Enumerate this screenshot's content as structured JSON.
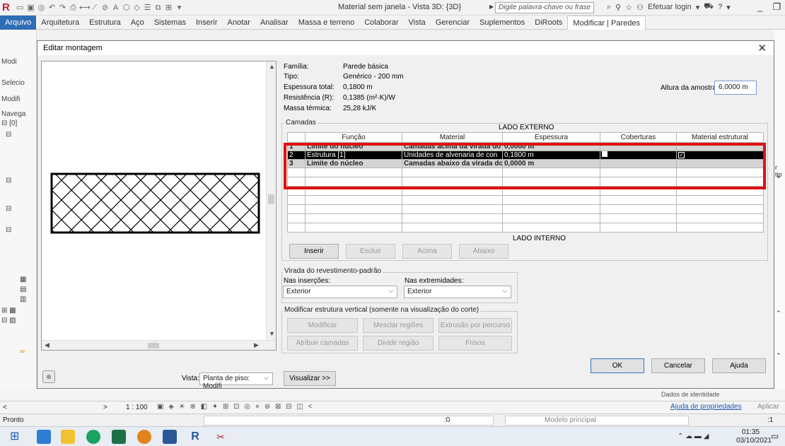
{
  "app": {
    "window_title": "Material sem janela - Vista 3D: {3D}",
    "search_placeholder": "Digite palavra-chave ou frase",
    "login": "Efetuar login",
    "ribbon_tabs": [
      "Arquivo",
      "Arquitetura",
      "Estrutura",
      "Aço",
      "Sistemas",
      "Inserir",
      "Anotar",
      "Analisar",
      "Massa e terreno",
      "Colaborar",
      "Vista",
      "Gerenciar",
      "Suplementos",
      "DiRoots",
      "Modificar | Paredes"
    ],
    "left_panel": {
      "modify": "Modi",
      "select": "Selecio",
      "modify2": "Modifi",
      "navigator": "Navega"
    }
  },
  "dialog": {
    "title": "Editar montagem",
    "properties": [
      {
        "label": "Família:",
        "value": "Parede básica"
      },
      {
        "label": "Tipo:",
        "value": "Genérico - 200 mm"
      },
      {
        "label": "Espessura total:",
        "value": "0,1800 m"
      },
      {
        "label": "Resistência (R):",
        "value": "0,1385 (m²·K)/W"
      },
      {
        "label": "Massa térmica:",
        "value": "25,28 kJ/K"
      }
    ],
    "sample_height_label": "Altura da amostra:",
    "sample_height_value": "6,0000 m",
    "layers_group": "Camadas",
    "exterior_side": "LADO EXTERNO",
    "interior_side": "LADO INTERNO",
    "columns": [
      "",
      "Função",
      "Material",
      "Espessura",
      "Coberturas",
      "Material estrutural"
    ],
    "rows": [
      {
        "num": "1",
        "function": "Limite do núcleo",
        "material": "Camadas acima da virada do re",
        "thickness": "0,0000 m"
      },
      {
        "num": "2",
        "function": "Estrutura [1]",
        "material": "Unidades de alvenaria de con",
        "thickness": "0,1800 m",
        "wraps": "checked",
        "structural": "checked"
      },
      {
        "num": "3",
        "function": "Limite do núcleo",
        "material": "Camadas abaixo da virada do r",
        "thickness": "0,0000 m"
      }
    ],
    "layer_buttons": {
      "insert": "Inserir",
      "delete": "Excluir",
      "up": "Acima",
      "down": "Abaixo"
    },
    "wrapping_group": "Virada do revestimento-padrão",
    "at_inserts_label": "Nas inserções:",
    "at_inserts_value": "Exterior",
    "at_ends_label": "Nas extremidades:",
    "at_ends_value": "Exterior",
    "vertical_group": "Modificar estrutura vertical (somente na visualização do corte)",
    "vertical_buttons": {
      "modify": "Modificar",
      "merge": "Mesclar regiões",
      "sweeps": "Extrusão por percurso",
      "assign": "Atribuir camadas",
      "split": "Dividir região",
      "reveals": "Frisos"
    },
    "view_label": "Vista:",
    "view_value": "Planta de piso: Modifi",
    "preview_button": "Visualizar >>",
    "ok": "OK",
    "cancel": "Cancelar",
    "help": "Ajuda"
  },
  "background": {
    "scale": "1 : 100",
    "right_tip": "r tip",
    "identity_data": "Dados de identidade",
    "properties_help": "Ajuda de propriedades",
    "apply": "Aplicar",
    "status": "Pronto",
    "coord": ":0",
    "model": "Modelo principal",
    "filter_count": ":1",
    "time": "01:35",
    "date": "03/10/2021"
  }
}
